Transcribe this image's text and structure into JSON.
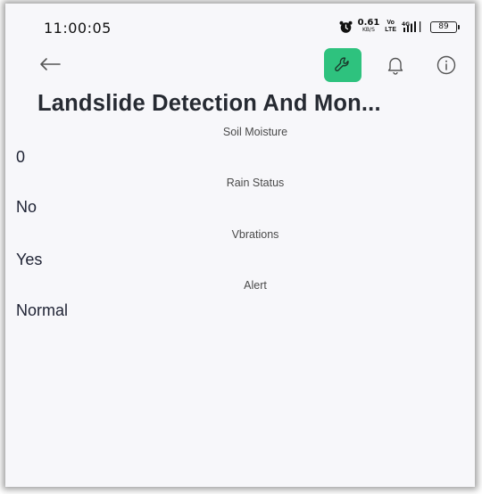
{
  "status_bar": {
    "time": "11:00:05",
    "net_speed_value": "0.61",
    "net_speed_unit": "KB/S",
    "volte_top": "Vo",
    "volte_bottom": "LTE",
    "network_type": "4G",
    "battery": "89",
    "icons": [
      "alarm-icon",
      "signal-icon",
      "battery-icon"
    ]
  },
  "app_bar": {
    "icons": [
      "back-arrow-icon",
      "wrench-icon",
      "bell-icon",
      "info-icon"
    ],
    "accent_color": "#2ec27e"
  },
  "page": {
    "title": "Landslide Detection And Mon..."
  },
  "fields": [
    {
      "label": "Soil Moisture",
      "value": "0"
    },
    {
      "label": "Rain Status",
      "value": "No"
    },
    {
      "label": "Vbrations",
      "value": "Yes"
    },
    {
      "label": "Alert",
      "value": "Normal"
    }
  ]
}
